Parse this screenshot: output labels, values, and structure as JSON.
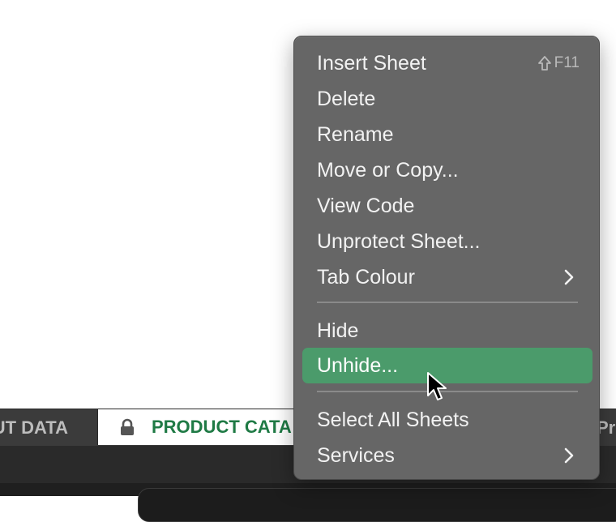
{
  "sheet_tabs": [
    {
      "label": "UT DATA"
    },
    {
      "label": "PRODUCT CATA"
    },
    {
      "label": "Pro"
    }
  ],
  "context_menu": {
    "items": [
      {
        "label": "Insert Sheet",
        "shortcut": "F11"
      },
      {
        "label": "Delete"
      },
      {
        "label": "Rename"
      },
      {
        "label": "Move or Copy..."
      },
      {
        "label": "View Code"
      },
      {
        "label": "Unprotect Sheet..."
      },
      {
        "label": "Tab Colour"
      },
      {
        "label": "Hide"
      },
      {
        "label": "Unhide..."
      },
      {
        "label": "Select All Sheets"
      },
      {
        "label": "Services"
      }
    ],
    "highlighted_item": "Unhide..."
  },
  "colors": {
    "menu_background": "#666666",
    "highlight": "#4b9b6b",
    "active_tab_text": "#1f7a45",
    "tab_bar": "#3b3b3b"
  },
  "icons": [
    "shift-icon",
    "chevron-right-icon",
    "lock-icon",
    "mouse-pointer-icon"
  ]
}
